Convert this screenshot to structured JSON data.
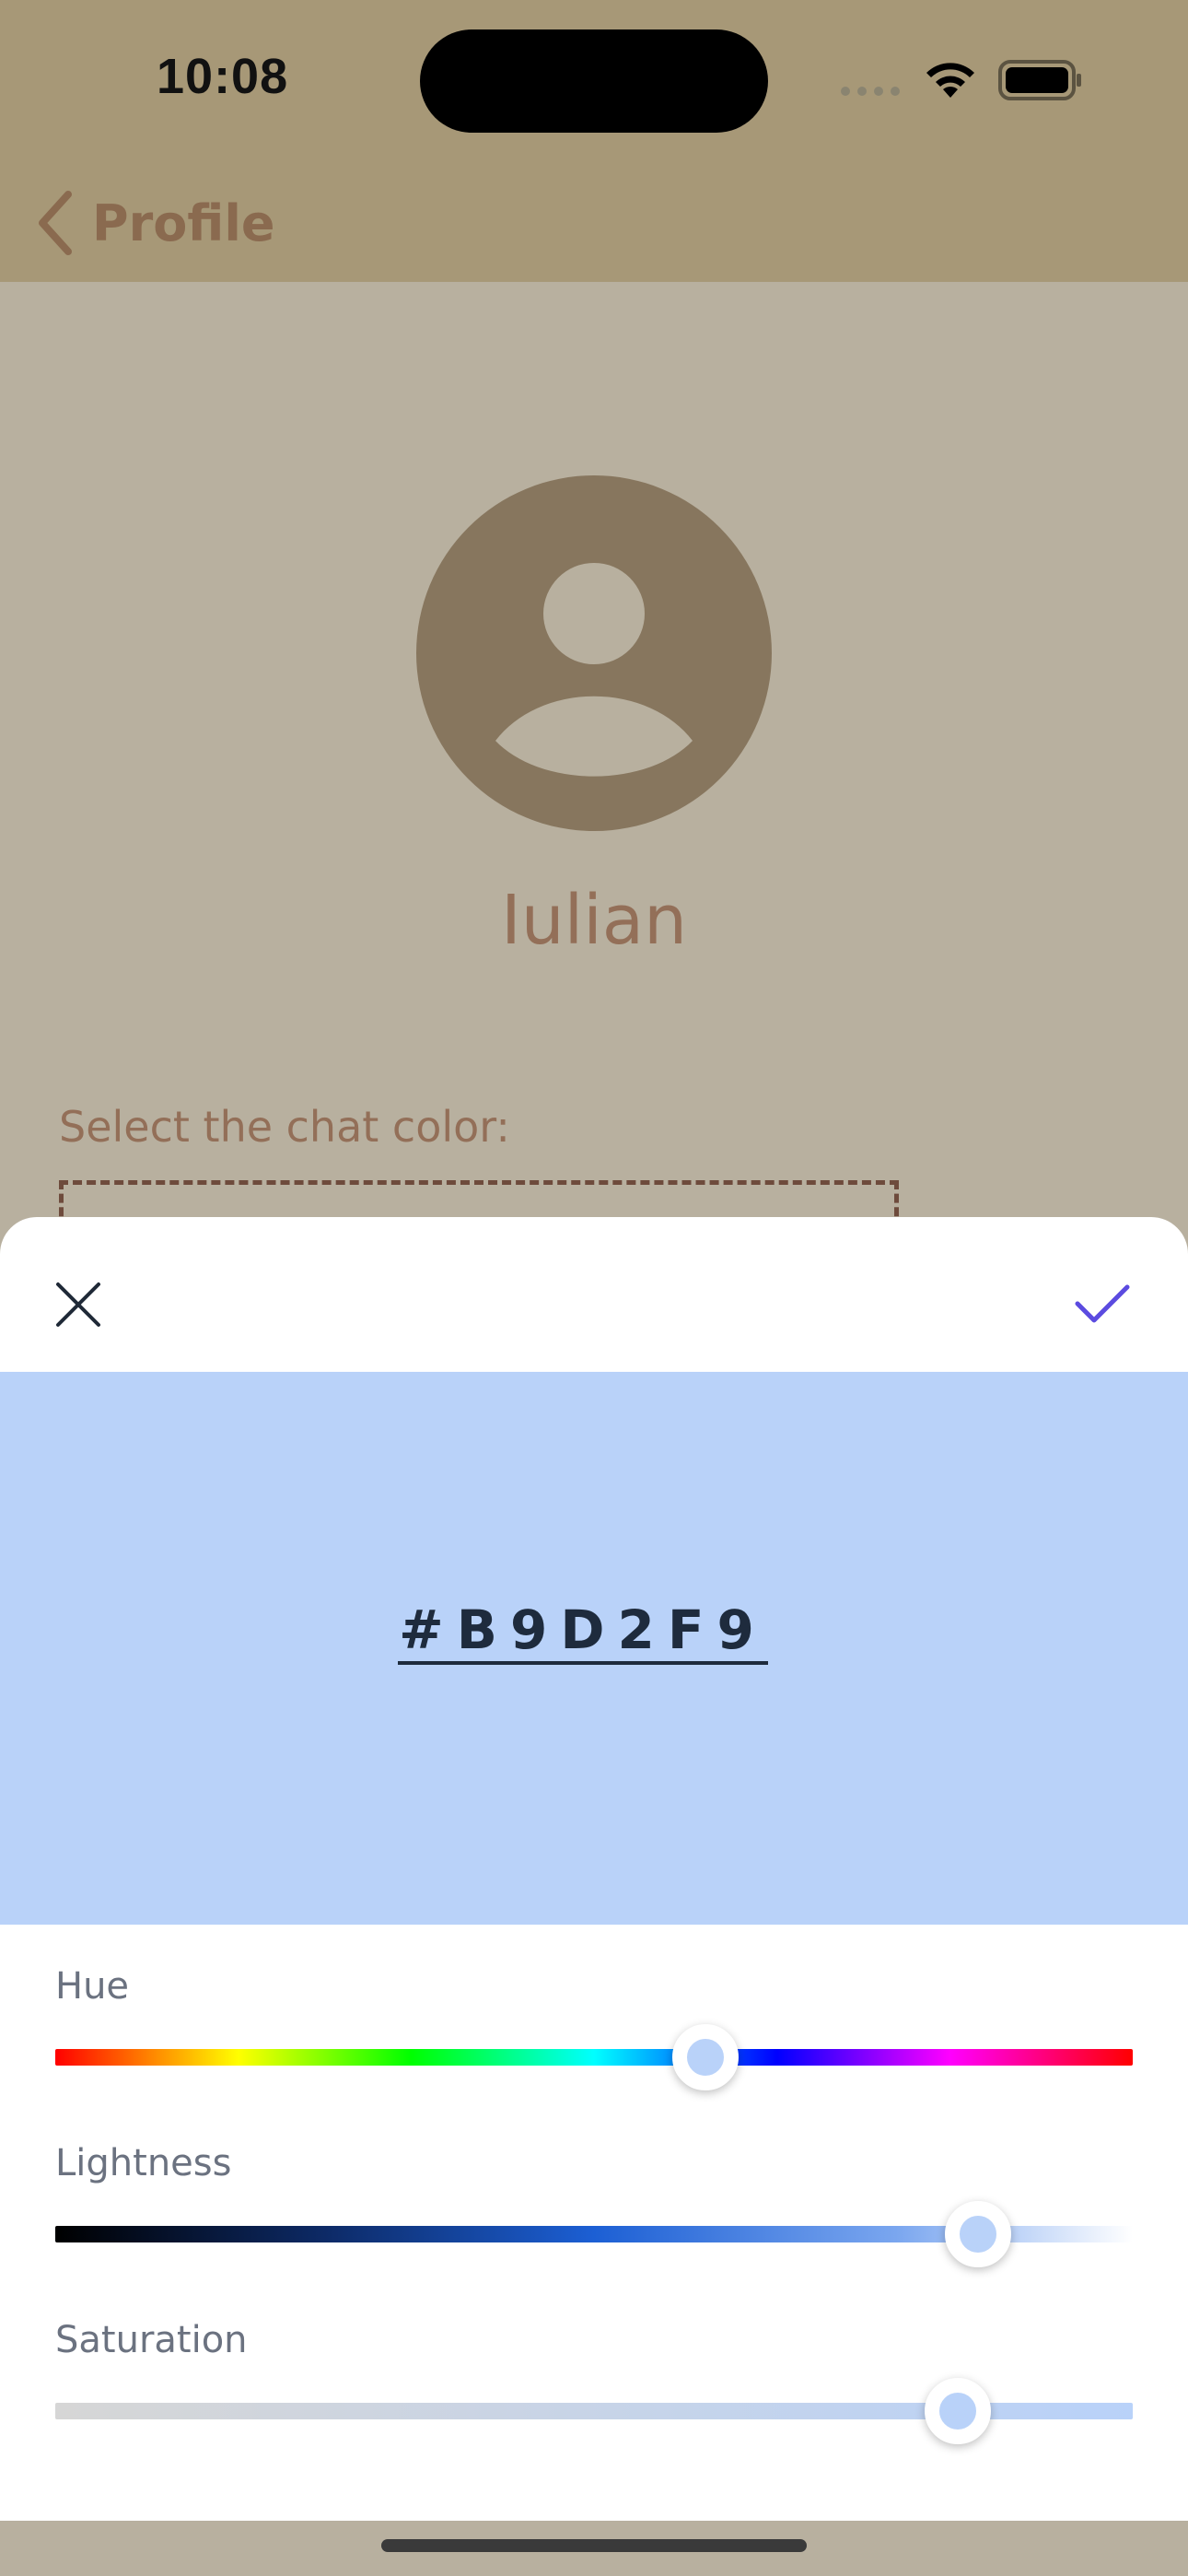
{
  "status_bar": {
    "time": "10:08"
  },
  "nav": {
    "back_label": "Profile"
  },
  "profile": {
    "name": "Iulian",
    "chat_color_label": "Select the chat color:"
  },
  "color_picker": {
    "hex_value": "#B9D2F9",
    "preview_color": "#B9D2F9",
    "accent_color": "#5B4BE0",
    "sliders": [
      {
        "label": "Hue",
        "value_fraction": 0.603
      },
      {
        "label": "Lightness",
        "value_fraction": 0.856
      },
      {
        "label": "Saturation",
        "value_fraction": 0.838
      }
    ],
    "icons": {
      "close": "close-icon",
      "confirm": "checkmark-icon"
    }
  },
  "colors": {
    "header_bg": "#A79877",
    "page_bg": "#B8B09F",
    "avatar_bg": "#87765E",
    "text_brown": "#936F58"
  }
}
